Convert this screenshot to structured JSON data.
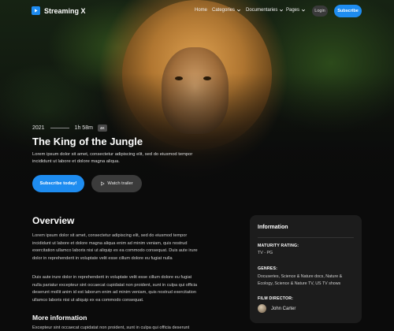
{
  "header": {
    "brand": "Streaming X",
    "nav": [
      {
        "label": "Home",
        "dropdown": false
      },
      {
        "label": "Categories",
        "dropdown": true
      },
      {
        "label": "Documentaries",
        "dropdown": true
      },
      {
        "label": "Pages",
        "dropdown": true
      }
    ],
    "login_label": "Login",
    "subscribe_label": "Subscribe"
  },
  "hero": {
    "year": "2021",
    "duration": "1h 58m",
    "quality_badge": "4K",
    "title": "The King of the Jungle",
    "description": "Lorem ipsum dolor sit amet, consectetur adipiscing elit, sed do eiusmod tempor incididunt ut labore et dolore magna aliqua.",
    "primary_cta": "Subscribe today!",
    "secondary_cta": "Watch trailer"
  },
  "overview": {
    "heading": "Overview",
    "paragraph1": "Lorem ipsum dolor sit amet, consectetur adipiscing elit, sed do eiusmod tempor incididunt ut labore et dolore magna aliqua enim ad minim veniam, quis nostrud exercitation ullamco laboris nisi ut aliquip ex ea commodo consequat. Duis aute irure dolor in reprehenderit in voluptate velit esse cillum dolore eu fugiat nulla",
    "paragraph2": "Duis aute irure dolor in reprehenderit in voluptate velit esse cillum dolore eu fugiat nulla pariatur excepteur sint occaecat cupidatat non proident, sunt in culpa qui officia deserunt mollit anim id est laborum enim ad minim veniam, quis nostrud exercitation ullamco laboris nisi ut aliquip ex ea commodo consequat.",
    "more_heading": "More information",
    "more_text": "Excepteur sint occaecat cupidatat non proident, sunt in culpa qui officia deserunt"
  },
  "info": {
    "title": "Information",
    "rating_label": "MATURITY RATING:",
    "rating_value": "TV - PG",
    "genres_label": "GENRES:",
    "genres_value": "Docuseries, Science & Nature docs, Nature & Ecology, Science & Nature TV, US TV shows",
    "director_label": "FILM DIRECTOR:",
    "director_name": "John Carter"
  },
  "colors": {
    "accent": "#1e8cf0",
    "background": "#0b0b0b",
    "card": "#1c1c1c"
  }
}
